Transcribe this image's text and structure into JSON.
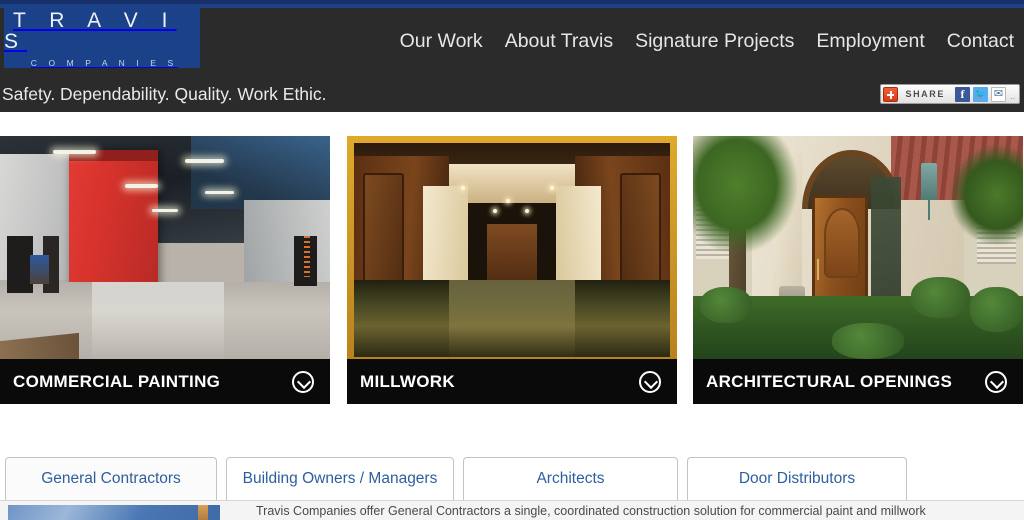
{
  "brand": {
    "logo_main": "T R A V I S",
    "logo_sub": "C O M P A N I E S",
    "tagline": "Safety. Dependability. Quality. Work Ethic.",
    "accent_blue": "#1b4289",
    "header_dark": "#2b2b2b",
    "link_blue": "#2d5f9e"
  },
  "nav": {
    "items": [
      {
        "label": "Our Work"
      },
      {
        "label": "About Travis"
      },
      {
        "label": "Signature Projects"
      },
      {
        "label": "Employment"
      },
      {
        "label": "Contact"
      }
    ]
  },
  "share": {
    "label": "SHARE",
    "plus_icon": "plus-icon",
    "buttons": [
      {
        "name": "facebook-icon",
        "glyph": "f"
      },
      {
        "name": "twitter-icon",
        "glyph": "bird"
      },
      {
        "name": "email-icon",
        "glyph": "envelope"
      }
    ],
    "more": ".."
  },
  "cards": [
    {
      "label": "COMMERCIAL PAINTING",
      "expand_icon": "chevron-down-circle-icon",
      "photo_alt": "industrial warehouse interior with red accent wall and polished concrete floor"
    },
    {
      "label": "MILLWORK",
      "expand_icon": "chevron-down-circle-icon",
      "photo_alt": "dark wood paneled elevator corridor with polished marble floor"
    },
    {
      "label": "ARCHITECTURAL OPENINGS",
      "expand_icon": "chevron-down-circle-icon",
      "photo_alt": "mediterranean style home entrance with carved wood door and palms"
    }
  ],
  "tabs": {
    "items": [
      {
        "label": "General Contractors",
        "active": true
      },
      {
        "label": "Building Owners / Managers",
        "active": false
      },
      {
        "label": "Architects",
        "active": false
      },
      {
        "label": "Door Distributors",
        "active": false
      }
    ]
  },
  "panel": {
    "thumb_alt": "building exterior thumbnail",
    "body": "Travis Companies offer General Contractors a single, coordinated construction solution for commercial paint and millwork"
  }
}
